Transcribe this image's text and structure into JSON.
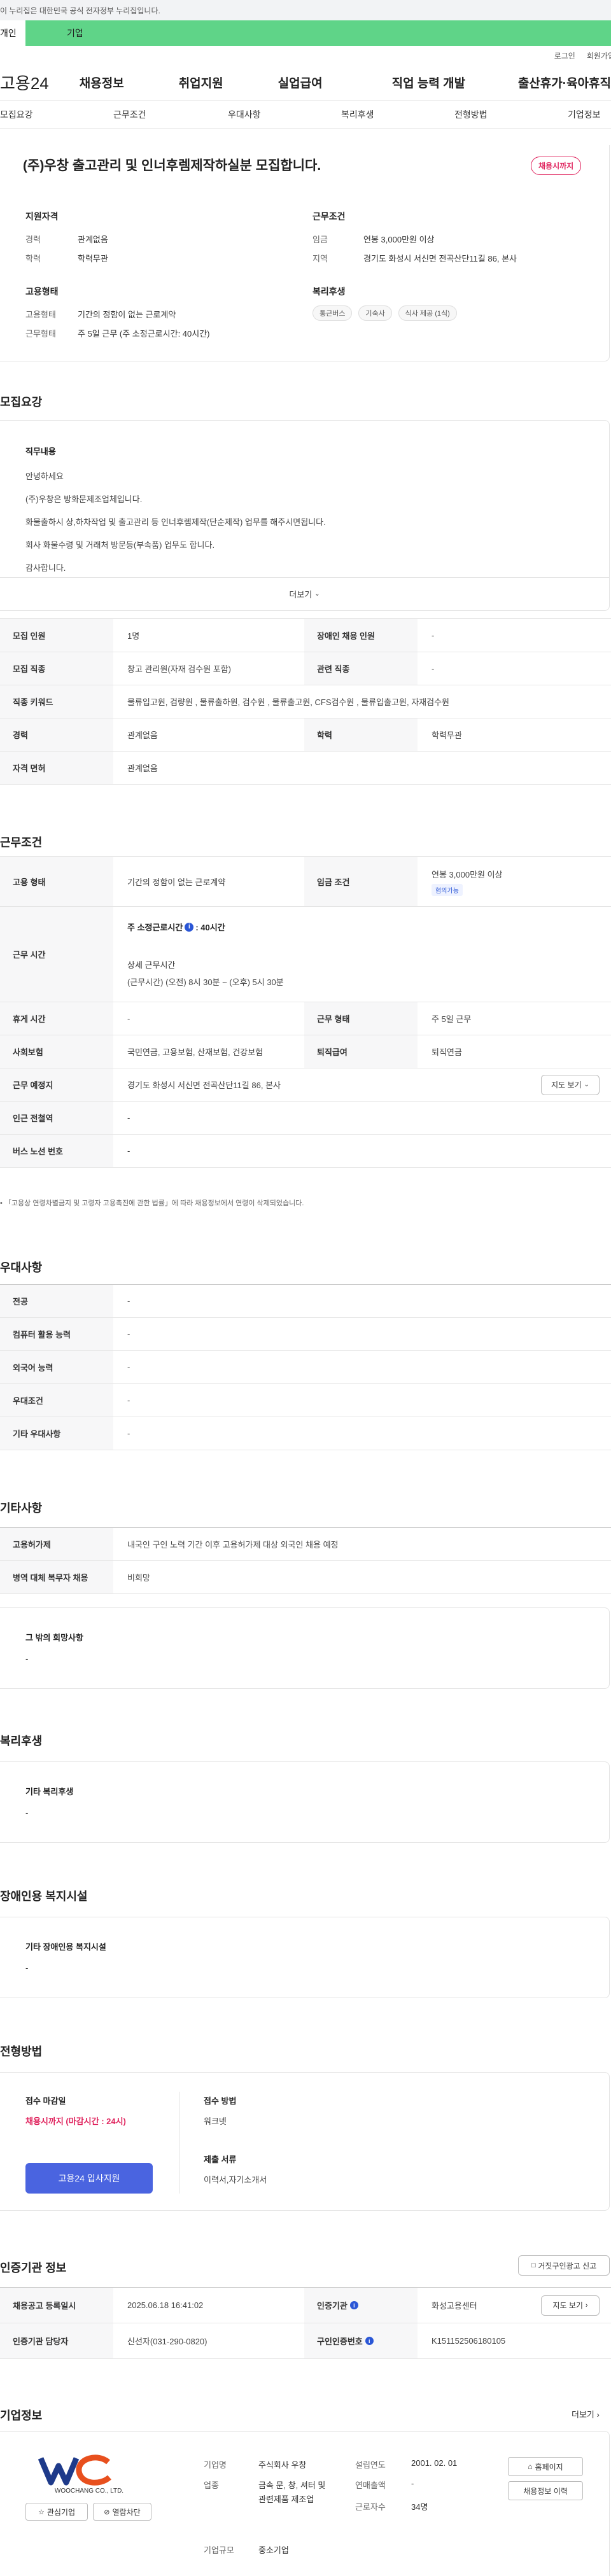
{
  "gov_banner": "이 누리집은 대한민국 공식 전자정부 누리집입니다.",
  "tabs": [
    "개인",
    "기업"
  ],
  "util": {
    "login": "로그인",
    "join": "회원가입"
  },
  "gnb": {
    "logo": "고용24",
    "items": [
      "채용정보",
      "취업지원",
      "실업급여",
      "직업 능력 개발",
      "출산휴가·육아휴직"
    ]
  },
  "subnav": [
    "모집요강",
    "근무조건",
    "우대사항",
    "복리후생",
    "전형방법",
    "기업정보"
  ],
  "summary": {
    "title": "(주)우창 출고관리 및 인너후렘제작하실분 모집합니다.",
    "status": "채용시까지",
    "qual_title": "지원자격",
    "career_label": "경력",
    "career_value": "관계없음",
    "edu_label": "학력",
    "edu_value": "학력무관",
    "cond_title": "근무조건",
    "wage_label": "임금",
    "wage_value": "연봉 3,000만원 이상",
    "region_label": "지역",
    "region_value": "경기도 화성시 서신면 전곡산단11길 86, 본사",
    "emp_title": "고용형태",
    "type_label": "고용형태",
    "type_value": "기간의 정함이 없는 근로계약",
    "hours_label": "근무형태",
    "hours_value": "주 5일 근무 (주 소정근로시간: 40시간)",
    "welfare_title": "복리후생",
    "welfare_tags": [
      "통근버스",
      "기숙사",
      "식사 제공 (1식)"
    ]
  },
  "recruit": {
    "heading": "모집요강",
    "desc_title": "직무내용",
    "desc_lines": [
      "안녕하세요",
      "(주)우창은 방화문제조업체입니다.",
      "화물출하시 상,하차작업 및 출고관리 등 인너후렘제작(단순제작) 업무를 해주시면됩니다.",
      "회사 화물수령 및 거래처 방문등(부속품) 업무도 합니다.",
      "감사합니다."
    ],
    "more": "더보기",
    "rows": [
      {
        "k1": "모집 인원",
        "v1": "1명",
        "k2": "장애인 채용 인원",
        "v2": "-"
      },
      {
        "k1": "모집 직종",
        "v1": "창고 관리원(자재 검수원 포함)",
        "k2": "관련 직종",
        "v2": "-"
      },
      {
        "k1": "직종 키워드",
        "v1": "물류입고원, 검량원 , 물류출하원, 검수원 , 물류출고원, CFS검수원 , 물류입출고원, 자재검수원"
      },
      {
        "k1": "경력",
        "v1": "관계없음",
        "k2": "학력",
        "v2": "학력무관"
      },
      {
        "k1": "자격 면허",
        "v1": "관계없음"
      }
    ]
  },
  "work": {
    "heading": "근무조건",
    "emp_type_k": "고용 형태",
    "emp_type_v": "기간의 정함이 없는 근로계약",
    "wage_k": "임금 조건",
    "wage_v": "연봉 3,000만원 이상",
    "wage_badge": "협의가능",
    "time_k": "근무 시간",
    "time_main": "주 소정근로시간",
    "time_hours": ": 40시간",
    "time_detail_t": "상세 근무시간",
    "time_detail_v": "(근무시간) (오전) 8시 30분 ~ (오후) 5시 30분",
    "rest_k": "휴게 시간",
    "rest_v": "-",
    "form_k": "근무 형태",
    "form_v": "주 5일 근무",
    "ins_k": "사회보험",
    "ins_v": "국민연금, 고용보험, 산재보험, 건강보험",
    "ret_k": "퇴직급여",
    "ret_v": "퇴직연금",
    "place_k": "근무 예정지",
    "place_v": "경기도 화성시 서신면 전곡산단11길 86, 본사",
    "map_btn": "지도 보기",
    "station_k": "인근 전철역",
    "station_v": "-",
    "bus_k": "버스 노선 번호",
    "bus_v": "-",
    "note": "「고용상 연령차별금지 및 고령자 고용촉진에 관한 법률」에 따라 채용정보에서 연령이 삭제되었습니다."
  },
  "pref": {
    "heading": "우대사항",
    "rows": [
      {
        "k": "전공",
        "v": "-"
      },
      {
        "k": "컴퓨터 활용 능력",
        "v": "-"
      },
      {
        "k": "외국어 능력",
        "v": "-"
      },
      {
        "k": "우대조건",
        "v": "-"
      },
      {
        "k": "기타 우대사항",
        "v": "-"
      }
    ]
  },
  "etc": {
    "heading": "기타사항",
    "rows": [
      {
        "k": "고용허가제",
        "v": "내국인 구인 노력 기간 이후 고용허가제 대상 외국인 채용 예정"
      },
      {
        "k": "병역 대체 복무자 채용",
        "v": "비희망"
      }
    ],
    "other_title": "그 밖의 희망사항",
    "other_value": "-"
  },
  "welfare": {
    "heading": "복리후생",
    "box_title": "기타 복리후생",
    "box_value": "-"
  },
  "disabled": {
    "heading": "장애인용 복지시설",
    "box_title": "기타 장애인용 복지시설",
    "box_value": "-"
  },
  "process": {
    "heading": "전형방법",
    "deadline_t": "접수 마감일",
    "deadline_v": "채용시까지 (마감시간 : 24시)",
    "apply_btn": "고용24 입사지원",
    "method_t": "접수 방법",
    "method_v": "워크넷",
    "docs_t": "제출 서류",
    "docs_v": "이력서,자기소개서"
  },
  "agency": {
    "heading": "인증기관 정보",
    "report_btn": "거짓구인광고 신고",
    "date_k": "채용공고 등록일시",
    "date_v": "2025.06.18 16:41:02",
    "org_k": "인증기관",
    "org_v": "화성고용센터",
    "map_btn": "지도 보기",
    "mgr_k": "인증기관 담당자",
    "mgr_v": "신선자(031-290-0820)",
    "no_k": "구인인증번호",
    "no_v": "K151152506180105"
  },
  "company": {
    "heading": "기업정보",
    "more": "더보기",
    "logo_text": "WOOCHANG CO., LTD.",
    "fav_btn": "관심기업",
    "block_btn": "열람차단",
    "name_k": "기업명",
    "name_v": "주식회사 우창",
    "est_k": "설립연도",
    "est_v": "2001. 02. 01",
    "ind_k": "업종",
    "ind_v": "금속 문, 창, 셔터 및 관련제품 제조업",
    "sales_k": "연매출액",
    "sales_v": "-",
    "emp_k": "근로자수",
    "emp_v": "34명",
    "size_k": "기업규모",
    "size_v": "중소기업",
    "home_btn": "홈페이지",
    "list_btn": "채용정보 이력"
  }
}
